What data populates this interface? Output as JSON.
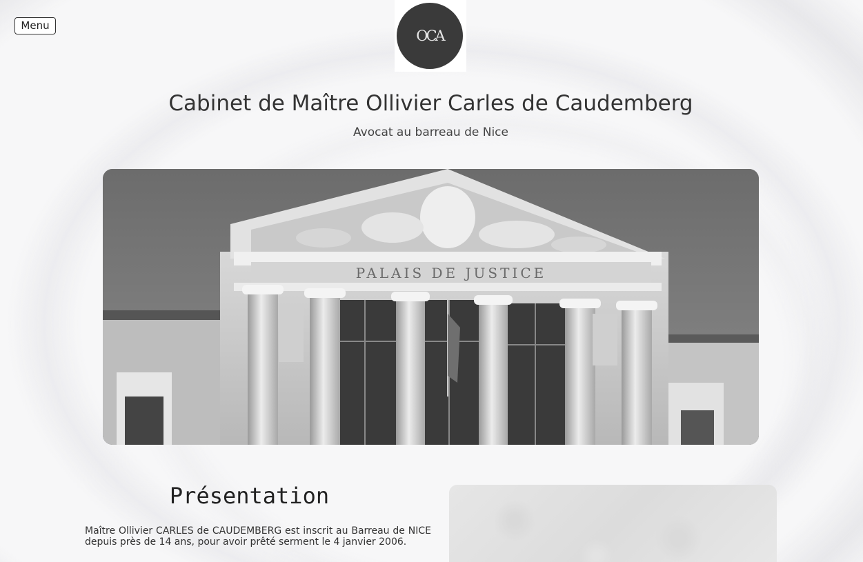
{
  "header": {
    "menu_label": "Menu",
    "logo_text": "OCA",
    "title": "Cabinet de Maître Ollivier Carles de Caudemberg",
    "subtitle": "Avocat au barreau de Nice"
  },
  "hero": {
    "inscription": "PALAIS DE JUSTICE"
  },
  "presentation": {
    "heading": "Présentation",
    "text": "Maître Ollivier CARLES de CAUDEMBERG est inscrit au Barreau de NICE depuis près de 14 ans, pour avoir prêté serment le 4 janvier 2006."
  }
}
